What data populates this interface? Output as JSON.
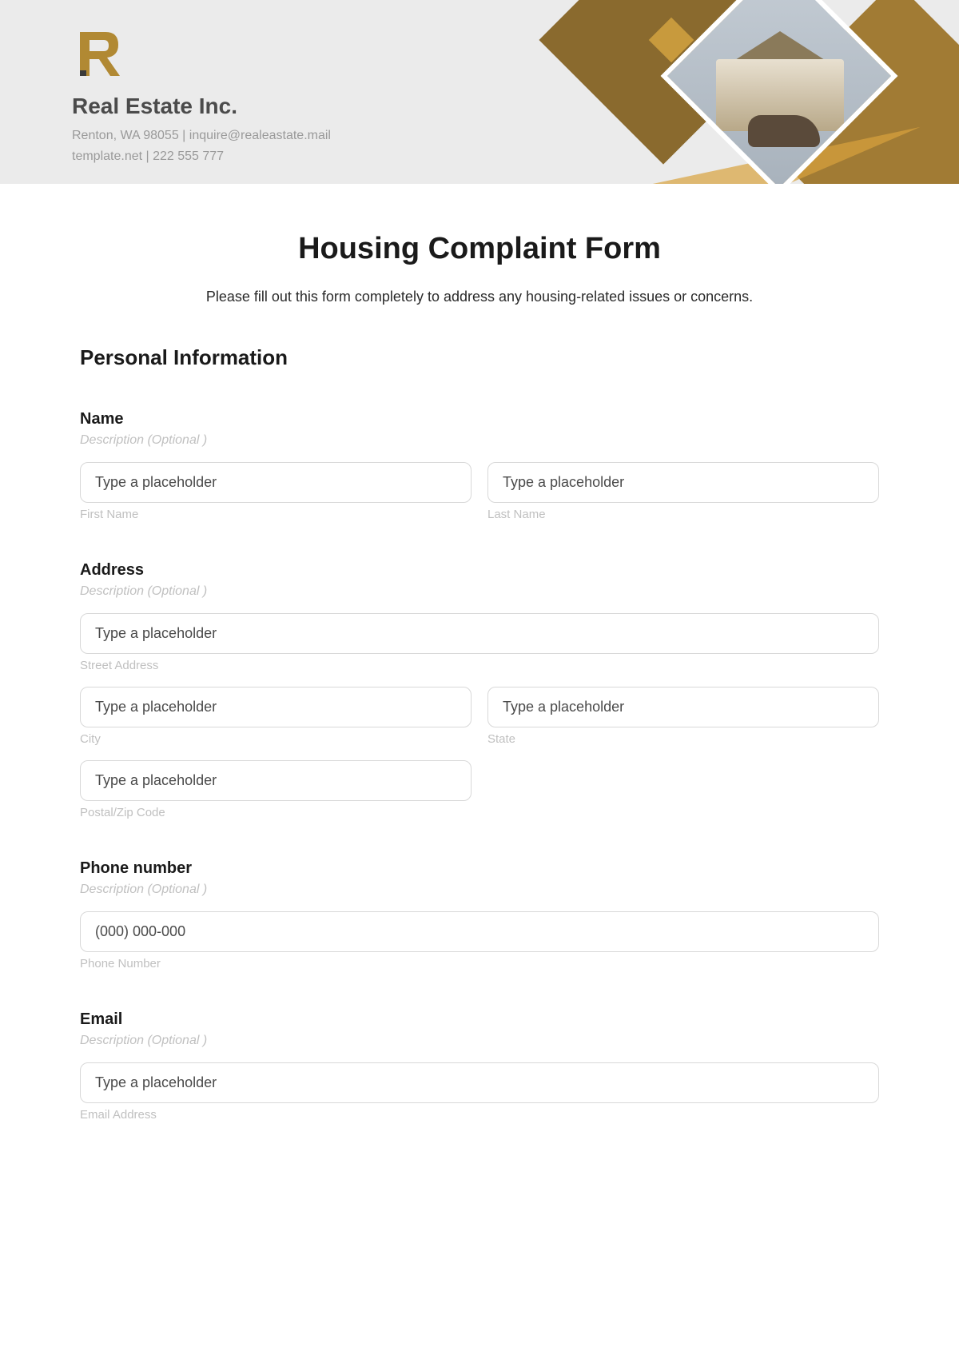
{
  "header": {
    "company_name": "Real Estate Inc.",
    "address_line": "Renton, WA 98055 | inquire@realeastate.mail",
    "contact_line": "template.net | 222 555 777"
  },
  "form": {
    "title": "Housing Complaint Form",
    "intro": "Please fill out this form completely to address any housing-related issues or concerns.",
    "section_personal": "Personal Information",
    "name": {
      "label": "Name",
      "description": "Description (Optional )",
      "first_placeholder": "Type a placeholder",
      "first_sub": "First Name",
      "last_placeholder": "Type a placeholder",
      "last_sub": "Last Name"
    },
    "address": {
      "label": "Address",
      "description": "Description (Optional )",
      "street_placeholder": "Type a placeholder",
      "street_sub": "Street Address",
      "city_placeholder": "Type a placeholder",
      "city_sub": "City",
      "state_placeholder": "Type a placeholder",
      "state_sub": "State",
      "postal_placeholder": "Type a placeholder",
      "postal_sub": "Postal/Zip Code"
    },
    "phone": {
      "label": "Phone number",
      "description": "Description (Optional )",
      "placeholder": "(000) 000-000",
      "sub": "Phone Number"
    },
    "email": {
      "label": "Email",
      "description": "Description (Optional )",
      "placeholder": "Type a placeholder",
      "sub": "Email Address"
    }
  }
}
